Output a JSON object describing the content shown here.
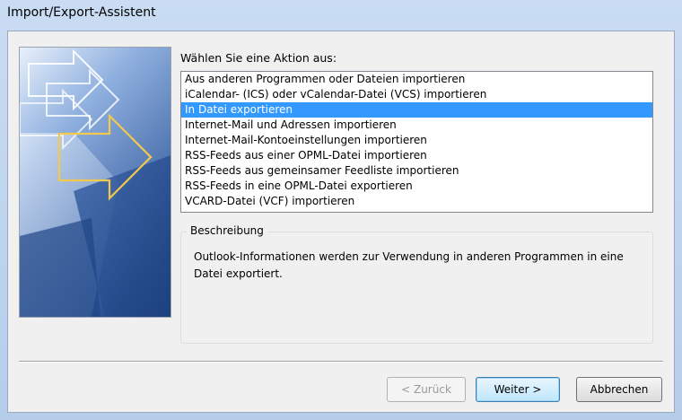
{
  "window": {
    "title": "Import/Export-Assistent"
  },
  "prompt": "Wählen Sie eine Aktion aus:",
  "actions": [
    "Aus anderen Programmen oder Dateien importieren",
    "iCalendar- (ICS) oder vCalendar-Datei (VCS) importieren",
    "In Datei exportieren",
    "Internet-Mail und Adressen importieren",
    "Internet-Mail-Kontoeinstellungen importieren",
    "RSS-Feeds aus einer OPML-Datei importieren",
    "RSS-Feeds aus gemeinsamer Feedliste importieren",
    "RSS-Feeds in eine OPML-Datei exportieren",
    "VCARD-Datei (VCF) importieren"
  ],
  "selected_index": 2,
  "description": {
    "label": "Beschreibung",
    "text": "Outlook-Informationen werden zur Verwendung in anderen Programmen in eine Datei exportiert."
  },
  "buttons": {
    "back": "< Zurück",
    "next": "Weiter >",
    "cancel": "Abbrechen"
  },
  "colors": {
    "selection": "#3399ff",
    "art_blue_dark": "#2a4f8f",
    "art_blue_light": "#9fbde6",
    "arrow_yellow": "#f2c94c"
  },
  "icons": {
    "wizard_art": "arrows-illustration"
  }
}
